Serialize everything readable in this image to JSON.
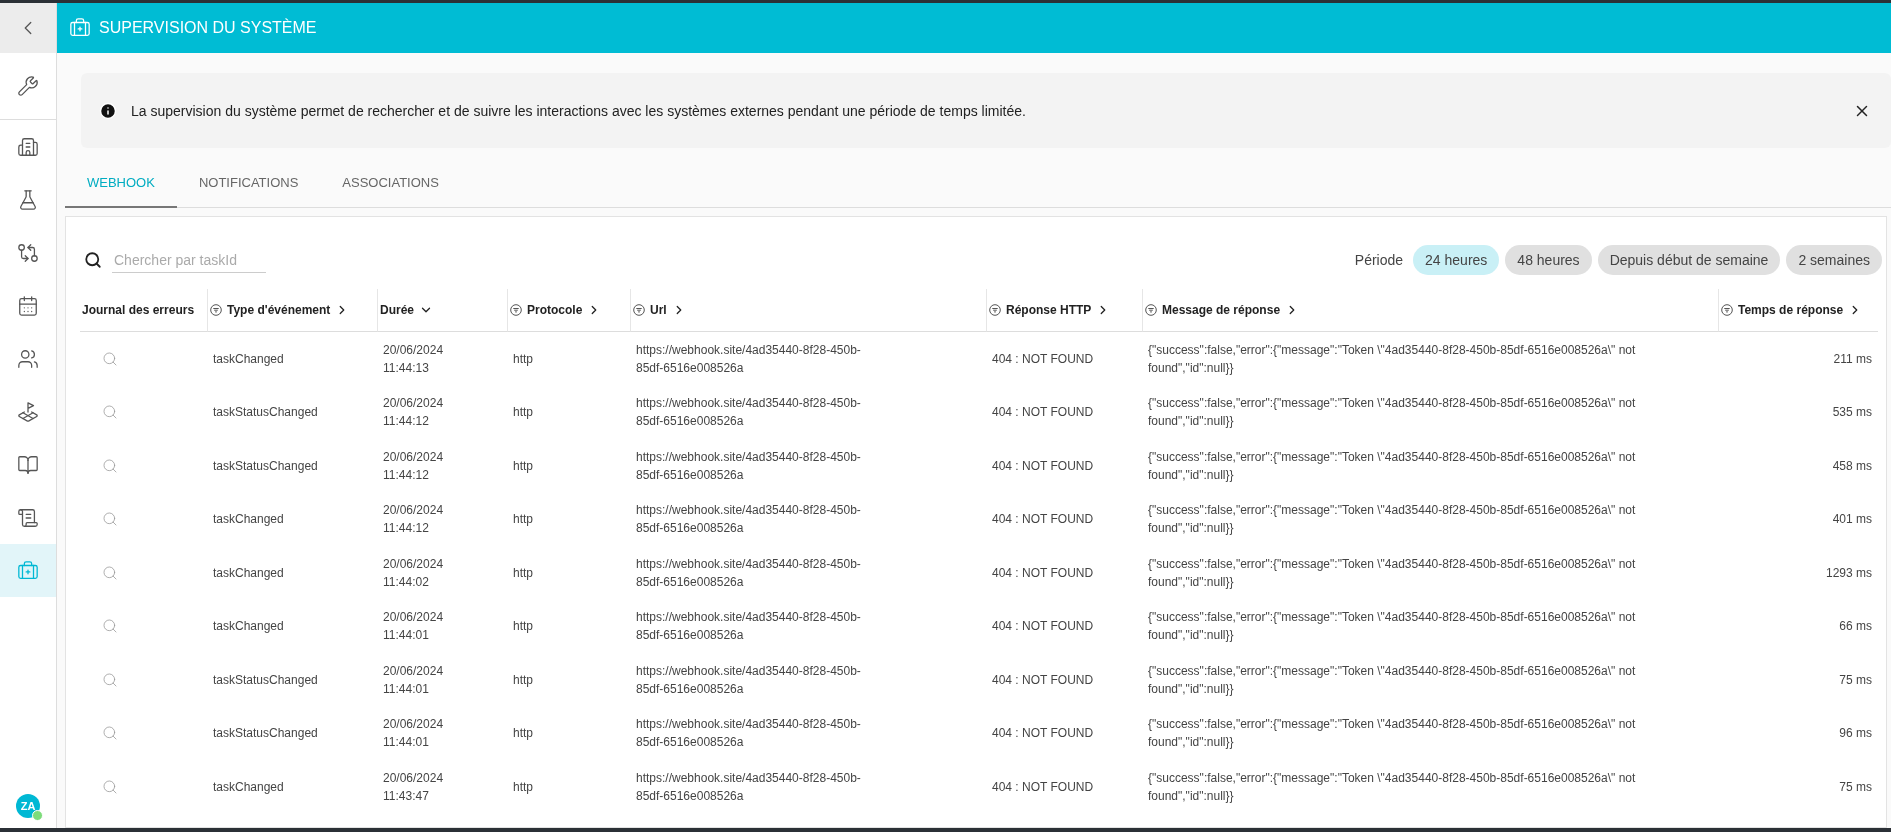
{
  "header": {
    "title": "SUPERVISION DU SYSTÈME"
  },
  "sidebar": {
    "items": [
      {
        "selected": false
      },
      {
        "selected": false
      },
      {
        "selected": false
      },
      {
        "selected": false
      },
      {
        "selected": false
      },
      {
        "selected": false
      },
      {
        "selected": false
      },
      {
        "selected": false
      },
      {
        "selected": false
      },
      {
        "selected": true
      }
    ],
    "avatar": {
      "initials": "ZA",
      "online": true
    }
  },
  "info": {
    "text": "La supervision du système permet de rechercher et de suivre les interactions avec les systèmes externes pendant une période de temps limitée."
  },
  "tabs": [
    {
      "label": "WEBHOOK",
      "selected": true
    },
    {
      "label": "NOTIFICATIONS",
      "selected": false
    },
    {
      "label": "ASSOCIATIONS",
      "selected": false
    }
  ],
  "search": {
    "placeholder": "Chercher par taskId"
  },
  "period": {
    "label": "Période",
    "options": [
      {
        "label": "24 heures",
        "selected": true
      },
      {
        "label": "48 heures",
        "selected": false
      },
      {
        "label": "Depuis début de semaine",
        "selected": false
      },
      {
        "label": "2 semaines",
        "selected": false
      }
    ]
  },
  "table": {
    "columns": [
      {
        "label": "Journal des erreurs",
        "kind": "plain",
        "filter": false
      },
      {
        "label": "Type d'événement",
        "kind": "sortable",
        "filter": true,
        "sorted": false
      },
      {
        "label": "Durée",
        "kind": "sortable",
        "filter": false,
        "sorted": true
      },
      {
        "label": "Protocole",
        "kind": "sortable",
        "filter": true,
        "sorted": false
      },
      {
        "label": "Url",
        "kind": "sortable",
        "filter": true,
        "sorted": false
      },
      {
        "label": "Réponse HTTP",
        "kind": "sortable",
        "filter": true,
        "sorted": false
      },
      {
        "label": "Message de réponse",
        "kind": "sortable",
        "filter": true,
        "sorted": false
      },
      {
        "label": "Temps de réponse",
        "kind": "sortable",
        "filter": true,
        "sorted": false
      }
    ],
    "rows": [
      {
        "type": "taskChanged",
        "date": "20/06/2024",
        "time": "11:44:13",
        "protocol": "http",
        "url": "https://webhook.site/4ad35440-8f28-450b-85df-6516e008526a",
        "http": "404 : NOT FOUND",
        "message": "{\"success\":false,\"error\":{\"message\":\"Token \\\"4ad35440-8f28-450b-85df-6516e008526a\\\" not found\",\"id\":null}}",
        "response_time": "211 ms"
      },
      {
        "type": "taskStatusChanged",
        "date": "20/06/2024",
        "time": "11:44:12",
        "protocol": "http",
        "url": "https://webhook.site/4ad35440-8f28-450b-85df-6516e008526a",
        "http": "404 : NOT FOUND",
        "message": "{\"success\":false,\"error\":{\"message\":\"Token \\\"4ad35440-8f28-450b-85df-6516e008526a\\\" not found\",\"id\":null}}",
        "response_time": "535 ms"
      },
      {
        "type": "taskStatusChanged",
        "date": "20/06/2024",
        "time": "11:44:12",
        "protocol": "http",
        "url": "https://webhook.site/4ad35440-8f28-450b-85df-6516e008526a",
        "http": "404 : NOT FOUND",
        "message": "{\"success\":false,\"error\":{\"message\":\"Token \\\"4ad35440-8f28-450b-85df-6516e008526a\\\" not found\",\"id\":null}}",
        "response_time": "458 ms"
      },
      {
        "type": "taskChanged",
        "date": "20/06/2024",
        "time": "11:44:12",
        "protocol": "http",
        "url": "https://webhook.site/4ad35440-8f28-450b-85df-6516e008526a",
        "http": "404 : NOT FOUND",
        "message": "{\"success\":false,\"error\":{\"message\":\"Token \\\"4ad35440-8f28-450b-85df-6516e008526a\\\" not found\",\"id\":null}}",
        "response_time": "401 ms"
      },
      {
        "type": "taskChanged",
        "date": "20/06/2024",
        "time": "11:44:02",
        "protocol": "http",
        "url": "https://webhook.site/4ad35440-8f28-450b-85df-6516e008526a",
        "http": "404 : NOT FOUND",
        "message": "{\"success\":false,\"error\":{\"message\":\"Token \\\"4ad35440-8f28-450b-85df-6516e008526a\\\" not found\",\"id\":null}}",
        "response_time": "1293 ms"
      },
      {
        "type": "taskChanged",
        "date": "20/06/2024",
        "time": "11:44:01",
        "protocol": "http",
        "url": "https://webhook.site/4ad35440-8f28-450b-85df-6516e008526a",
        "http": "404 : NOT FOUND",
        "message": "{\"success\":false,\"error\":{\"message\":\"Token \\\"4ad35440-8f28-450b-85df-6516e008526a\\\" not found\",\"id\":null}}",
        "response_time": "66 ms"
      },
      {
        "type": "taskStatusChanged",
        "date": "20/06/2024",
        "time": "11:44:01",
        "protocol": "http",
        "url": "https://webhook.site/4ad35440-8f28-450b-85df-6516e008526a",
        "http": "404 : NOT FOUND",
        "message": "{\"success\":false,\"error\":{\"message\":\"Token \\\"4ad35440-8f28-450b-85df-6516e008526a\\\" not found\",\"id\":null}}",
        "response_time": "75 ms"
      },
      {
        "type": "taskStatusChanged",
        "date": "20/06/2024",
        "time": "11:44:01",
        "protocol": "http",
        "url": "https://webhook.site/4ad35440-8f28-450b-85df-6516e008526a",
        "http": "404 : NOT FOUND",
        "message": "{\"success\":false,\"error\":{\"message\":\"Token \\\"4ad35440-8f28-450b-85df-6516e008526a\\\" not found\",\"id\":null}}",
        "response_time": "96 ms"
      },
      {
        "type": "taskChanged",
        "date": "20/06/2024",
        "time": "11:43:47",
        "protocol": "http",
        "url": "https://webhook.site/4ad35440-8f28-450b-85df-6516e008526a",
        "http": "404 : NOT FOUND",
        "message": "{\"success\":false,\"error\":{\"message\":\"Token \\\"4ad35440-8f28-450b-85df-6516e008526a\\\" not found\",\"id\":null}}",
        "response_time": "75 ms"
      }
    ]
  }
}
